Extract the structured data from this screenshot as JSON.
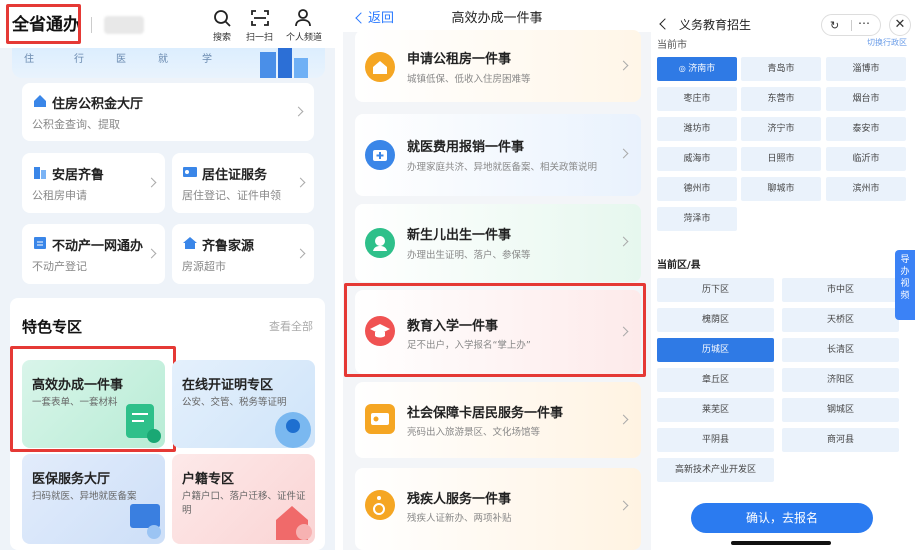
{
  "panel1": {
    "app_title": "全省通办",
    "tools": [
      {
        "label": "搜索",
        "icon": "search-icon"
      },
      {
        "label": "扫一扫",
        "icon": "scan-icon"
      },
      {
        "label": "个人频道",
        "icon": "person-icon"
      }
    ],
    "banner_fragments": [
      "住",
      "行",
      "医",
      "就",
      "学"
    ],
    "housing_fund": {
      "title": "住房公积金大厅",
      "subtitle": "公积金查询、提取"
    },
    "cards": [
      {
        "title": "安居齐鲁",
        "subtitle": "公租房申请"
      },
      {
        "title": "居住证服务",
        "subtitle": "居住登记、证件申领"
      },
      {
        "title": "不动产一网通办",
        "subtitle": "不动产登记"
      },
      {
        "title": "齐鲁家源",
        "subtitle": "房源超市"
      }
    ],
    "section": {
      "title": "特色专区",
      "more": "查看全部"
    },
    "tiles": [
      {
        "title": "高效办成一件事",
        "subtitle": "一套表单、一套材料"
      },
      {
        "title": "在线开证明专区",
        "subtitle": "公安、交管、税务等证明"
      },
      {
        "title": "医保服务大厅",
        "subtitle": "扫码就医、异地就医备案"
      },
      {
        "title": "户籍专区",
        "subtitle": "户籍户口、落户迁移、证件证明"
      }
    ]
  },
  "panel2": {
    "back": "返回",
    "title": "高效办成一件事",
    "items": [
      {
        "title": "申请公租房一件事",
        "subtitle": "城镇低保、低收入住房困难等"
      },
      {
        "title": "就医费用报销一件事",
        "subtitle": "办理家庭共济、异地就医备案、相关政策说明"
      },
      {
        "title": "新生儿出生一件事",
        "subtitle": "办理出生证明、落户、参保等"
      },
      {
        "title": "教育入学一件事",
        "subtitle": "足不出户，入学报名“掌上办”"
      },
      {
        "title": "社会保障卡居民服务一件事",
        "subtitle": "亮码出入旅游景区、文化场馆等"
      },
      {
        "title": "残疾人服务一件事",
        "subtitle": "残疾人证新办、两项补贴"
      }
    ]
  },
  "panel3": {
    "title": "义务教育招生",
    "city_header": "当前市",
    "top_link": "切换行政区",
    "cities": [
      "济南市",
      "青岛市",
      "淄博市",
      "枣庄市",
      "东营市",
      "烟台市",
      "潍坊市",
      "济宁市",
      "泰安市",
      "威海市",
      "日照市",
      "临沂市",
      "德州市",
      "聊城市",
      "滨州市",
      "菏泽市"
    ],
    "selected_city": "济南市",
    "district_label": "当前区/县",
    "districts": [
      "历下区",
      "市中区",
      "槐荫区",
      "天桥区",
      "历城区",
      "长清区",
      "章丘区",
      "济阳区",
      "莱芜区",
      "钢城区",
      "平阴县",
      "商河县",
      "高新技术产业开发区"
    ],
    "selected_district": "历城区",
    "side_tab": "导办视频",
    "confirm": "确认，去报名"
  }
}
